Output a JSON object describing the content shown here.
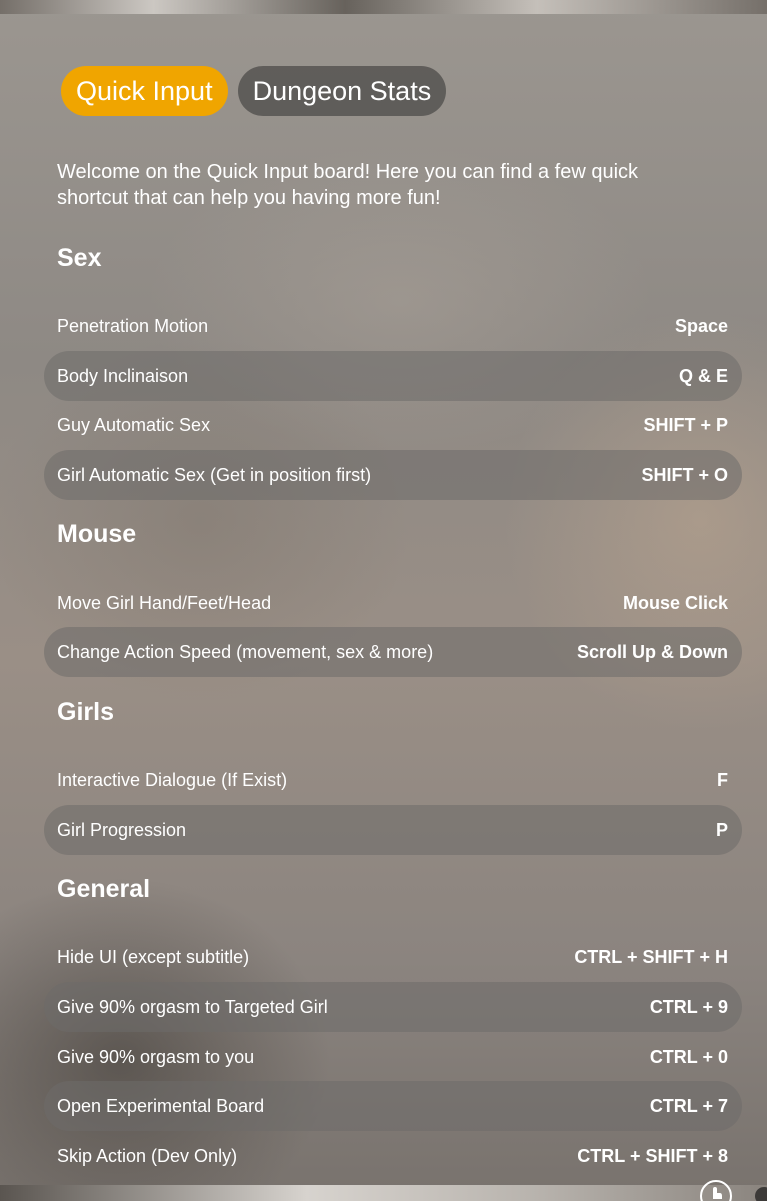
{
  "tabs": [
    {
      "label": "Quick Input"
    },
    {
      "label": "Dungeon Stats"
    }
  ],
  "intro": "Welcome on the Quick Input board! Here you can find a few quick shortcut that can help you having more fun!",
  "sections": [
    {
      "title": "Sex",
      "rows": [
        {
          "action": "Penetration Motion",
          "key": "Space"
        },
        {
          "action": "Body Inclinaison",
          "key": "Q & E"
        },
        {
          "action": "Guy Automatic Sex",
          "key": "SHIFT + P"
        },
        {
          "action": "Girl Automatic Sex (Get in position first)",
          "key": "SHIFT + O"
        }
      ]
    },
    {
      "title": "Mouse",
      "rows": [
        {
          "action": "Move Girl Hand/Feet/Head",
          "key": "Mouse Click"
        },
        {
          "action": "Change Action Speed (movement, sex & more)",
          "key": "Scroll Up & Down"
        }
      ]
    },
    {
      "title": "Girls",
      "rows": [
        {
          "action": "Interactive Dialogue (If Exist)",
          "key": "F"
        },
        {
          "action": "Girl Progression",
          "key": "P"
        }
      ]
    },
    {
      "title": "General",
      "rows": [
        {
          "action": "Hide UI (except subtitle)",
          "key": "CTRL + SHIFT + H"
        },
        {
          "action": "Give 90% orgasm to Targeted Girl",
          "key": "CTRL + 9"
        },
        {
          "action": "Give 90% orgasm to you",
          "key": "CTRL + 0"
        },
        {
          "action": "Open Experimental Board",
          "key": "CTRL + 7"
        },
        {
          "action": "Skip Action (Dev Only)",
          "key": "CTRL + SHIFT + 8"
        }
      ]
    }
  ],
  "colors": {
    "accent": "#f0a500",
    "tab_inactive": "#504e4c"
  }
}
